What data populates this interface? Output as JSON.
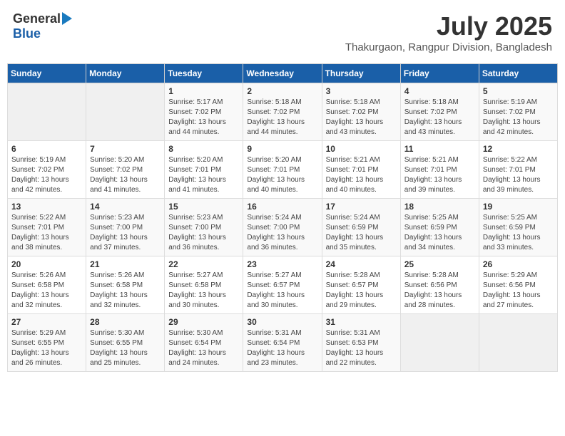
{
  "header": {
    "logo": {
      "line1": "General",
      "line2": "Blue"
    },
    "title": "July 2025",
    "subtitle": "Thakurgaon, Rangpur Division, Bangladesh"
  },
  "weekdays": [
    "Sunday",
    "Monday",
    "Tuesday",
    "Wednesday",
    "Thursday",
    "Friday",
    "Saturday"
  ],
  "weeks": [
    [
      {
        "day": "",
        "sunrise": "",
        "sunset": "",
        "daylight": ""
      },
      {
        "day": "",
        "sunrise": "",
        "sunset": "",
        "daylight": ""
      },
      {
        "day": "1",
        "sunrise": "Sunrise: 5:17 AM",
        "sunset": "Sunset: 7:02 PM",
        "daylight": "Daylight: 13 hours and 44 minutes."
      },
      {
        "day": "2",
        "sunrise": "Sunrise: 5:18 AM",
        "sunset": "Sunset: 7:02 PM",
        "daylight": "Daylight: 13 hours and 44 minutes."
      },
      {
        "day": "3",
        "sunrise": "Sunrise: 5:18 AM",
        "sunset": "Sunset: 7:02 PM",
        "daylight": "Daylight: 13 hours and 43 minutes."
      },
      {
        "day": "4",
        "sunrise": "Sunrise: 5:18 AM",
        "sunset": "Sunset: 7:02 PM",
        "daylight": "Daylight: 13 hours and 43 minutes."
      },
      {
        "day": "5",
        "sunrise": "Sunrise: 5:19 AM",
        "sunset": "Sunset: 7:02 PM",
        "daylight": "Daylight: 13 hours and 42 minutes."
      }
    ],
    [
      {
        "day": "6",
        "sunrise": "Sunrise: 5:19 AM",
        "sunset": "Sunset: 7:02 PM",
        "daylight": "Daylight: 13 hours and 42 minutes."
      },
      {
        "day": "7",
        "sunrise": "Sunrise: 5:20 AM",
        "sunset": "Sunset: 7:02 PM",
        "daylight": "Daylight: 13 hours and 41 minutes."
      },
      {
        "day": "8",
        "sunrise": "Sunrise: 5:20 AM",
        "sunset": "Sunset: 7:01 PM",
        "daylight": "Daylight: 13 hours and 41 minutes."
      },
      {
        "day": "9",
        "sunrise": "Sunrise: 5:20 AM",
        "sunset": "Sunset: 7:01 PM",
        "daylight": "Daylight: 13 hours and 40 minutes."
      },
      {
        "day": "10",
        "sunrise": "Sunrise: 5:21 AM",
        "sunset": "Sunset: 7:01 PM",
        "daylight": "Daylight: 13 hours and 40 minutes."
      },
      {
        "day": "11",
        "sunrise": "Sunrise: 5:21 AM",
        "sunset": "Sunset: 7:01 PM",
        "daylight": "Daylight: 13 hours and 39 minutes."
      },
      {
        "day": "12",
        "sunrise": "Sunrise: 5:22 AM",
        "sunset": "Sunset: 7:01 PM",
        "daylight": "Daylight: 13 hours and 39 minutes."
      }
    ],
    [
      {
        "day": "13",
        "sunrise": "Sunrise: 5:22 AM",
        "sunset": "Sunset: 7:01 PM",
        "daylight": "Daylight: 13 hours and 38 minutes."
      },
      {
        "day": "14",
        "sunrise": "Sunrise: 5:23 AM",
        "sunset": "Sunset: 7:00 PM",
        "daylight": "Daylight: 13 hours and 37 minutes."
      },
      {
        "day": "15",
        "sunrise": "Sunrise: 5:23 AM",
        "sunset": "Sunset: 7:00 PM",
        "daylight": "Daylight: 13 hours and 36 minutes."
      },
      {
        "day": "16",
        "sunrise": "Sunrise: 5:24 AM",
        "sunset": "Sunset: 7:00 PM",
        "daylight": "Daylight: 13 hours and 36 minutes."
      },
      {
        "day": "17",
        "sunrise": "Sunrise: 5:24 AM",
        "sunset": "Sunset: 6:59 PM",
        "daylight": "Daylight: 13 hours and 35 minutes."
      },
      {
        "day": "18",
        "sunrise": "Sunrise: 5:25 AM",
        "sunset": "Sunset: 6:59 PM",
        "daylight": "Daylight: 13 hours and 34 minutes."
      },
      {
        "day": "19",
        "sunrise": "Sunrise: 5:25 AM",
        "sunset": "Sunset: 6:59 PM",
        "daylight": "Daylight: 13 hours and 33 minutes."
      }
    ],
    [
      {
        "day": "20",
        "sunrise": "Sunrise: 5:26 AM",
        "sunset": "Sunset: 6:58 PM",
        "daylight": "Daylight: 13 hours and 32 minutes."
      },
      {
        "day": "21",
        "sunrise": "Sunrise: 5:26 AM",
        "sunset": "Sunset: 6:58 PM",
        "daylight": "Daylight: 13 hours and 32 minutes."
      },
      {
        "day": "22",
        "sunrise": "Sunrise: 5:27 AM",
        "sunset": "Sunset: 6:58 PM",
        "daylight": "Daylight: 13 hours and 30 minutes."
      },
      {
        "day": "23",
        "sunrise": "Sunrise: 5:27 AM",
        "sunset": "Sunset: 6:57 PM",
        "daylight": "Daylight: 13 hours and 30 minutes."
      },
      {
        "day": "24",
        "sunrise": "Sunrise: 5:28 AM",
        "sunset": "Sunset: 6:57 PM",
        "daylight": "Daylight: 13 hours and 29 minutes."
      },
      {
        "day": "25",
        "sunrise": "Sunrise: 5:28 AM",
        "sunset": "Sunset: 6:56 PM",
        "daylight": "Daylight: 13 hours and 28 minutes."
      },
      {
        "day": "26",
        "sunrise": "Sunrise: 5:29 AM",
        "sunset": "Sunset: 6:56 PM",
        "daylight": "Daylight: 13 hours and 27 minutes."
      }
    ],
    [
      {
        "day": "27",
        "sunrise": "Sunrise: 5:29 AM",
        "sunset": "Sunset: 6:55 PM",
        "daylight": "Daylight: 13 hours and 26 minutes."
      },
      {
        "day": "28",
        "sunrise": "Sunrise: 5:30 AM",
        "sunset": "Sunset: 6:55 PM",
        "daylight": "Daylight: 13 hours and 25 minutes."
      },
      {
        "day": "29",
        "sunrise": "Sunrise: 5:30 AM",
        "sunset": "Sunset: 6:54 PM",
        "daylight": "Daylight: 13 hours and 24 minutes."
      },
      {
        "day": "30",
        "sunrise": "Sunrise: 5:31 AM",
        "sunset": "Sunset: 6:54 PM",
        "daylight": "Daylight: 13 hours and 23 minutes."
      },
      {
        "day": "31",
        "sunrise": "Sunrise: 5:31 AM",
        "sunset": "Sunset: 6:53 PM",
        "daylight": "Daylight: 13 hours and 22 minutes."
      },
      {
        "day": "",
        "sunrise": "",
        "sunset": "",
        "daylight": ""
      },
      {
        "day": "",
        "sunrise": "",
        "sunset": "",
        "daylight": ""
      }
    ]
  ]
}
